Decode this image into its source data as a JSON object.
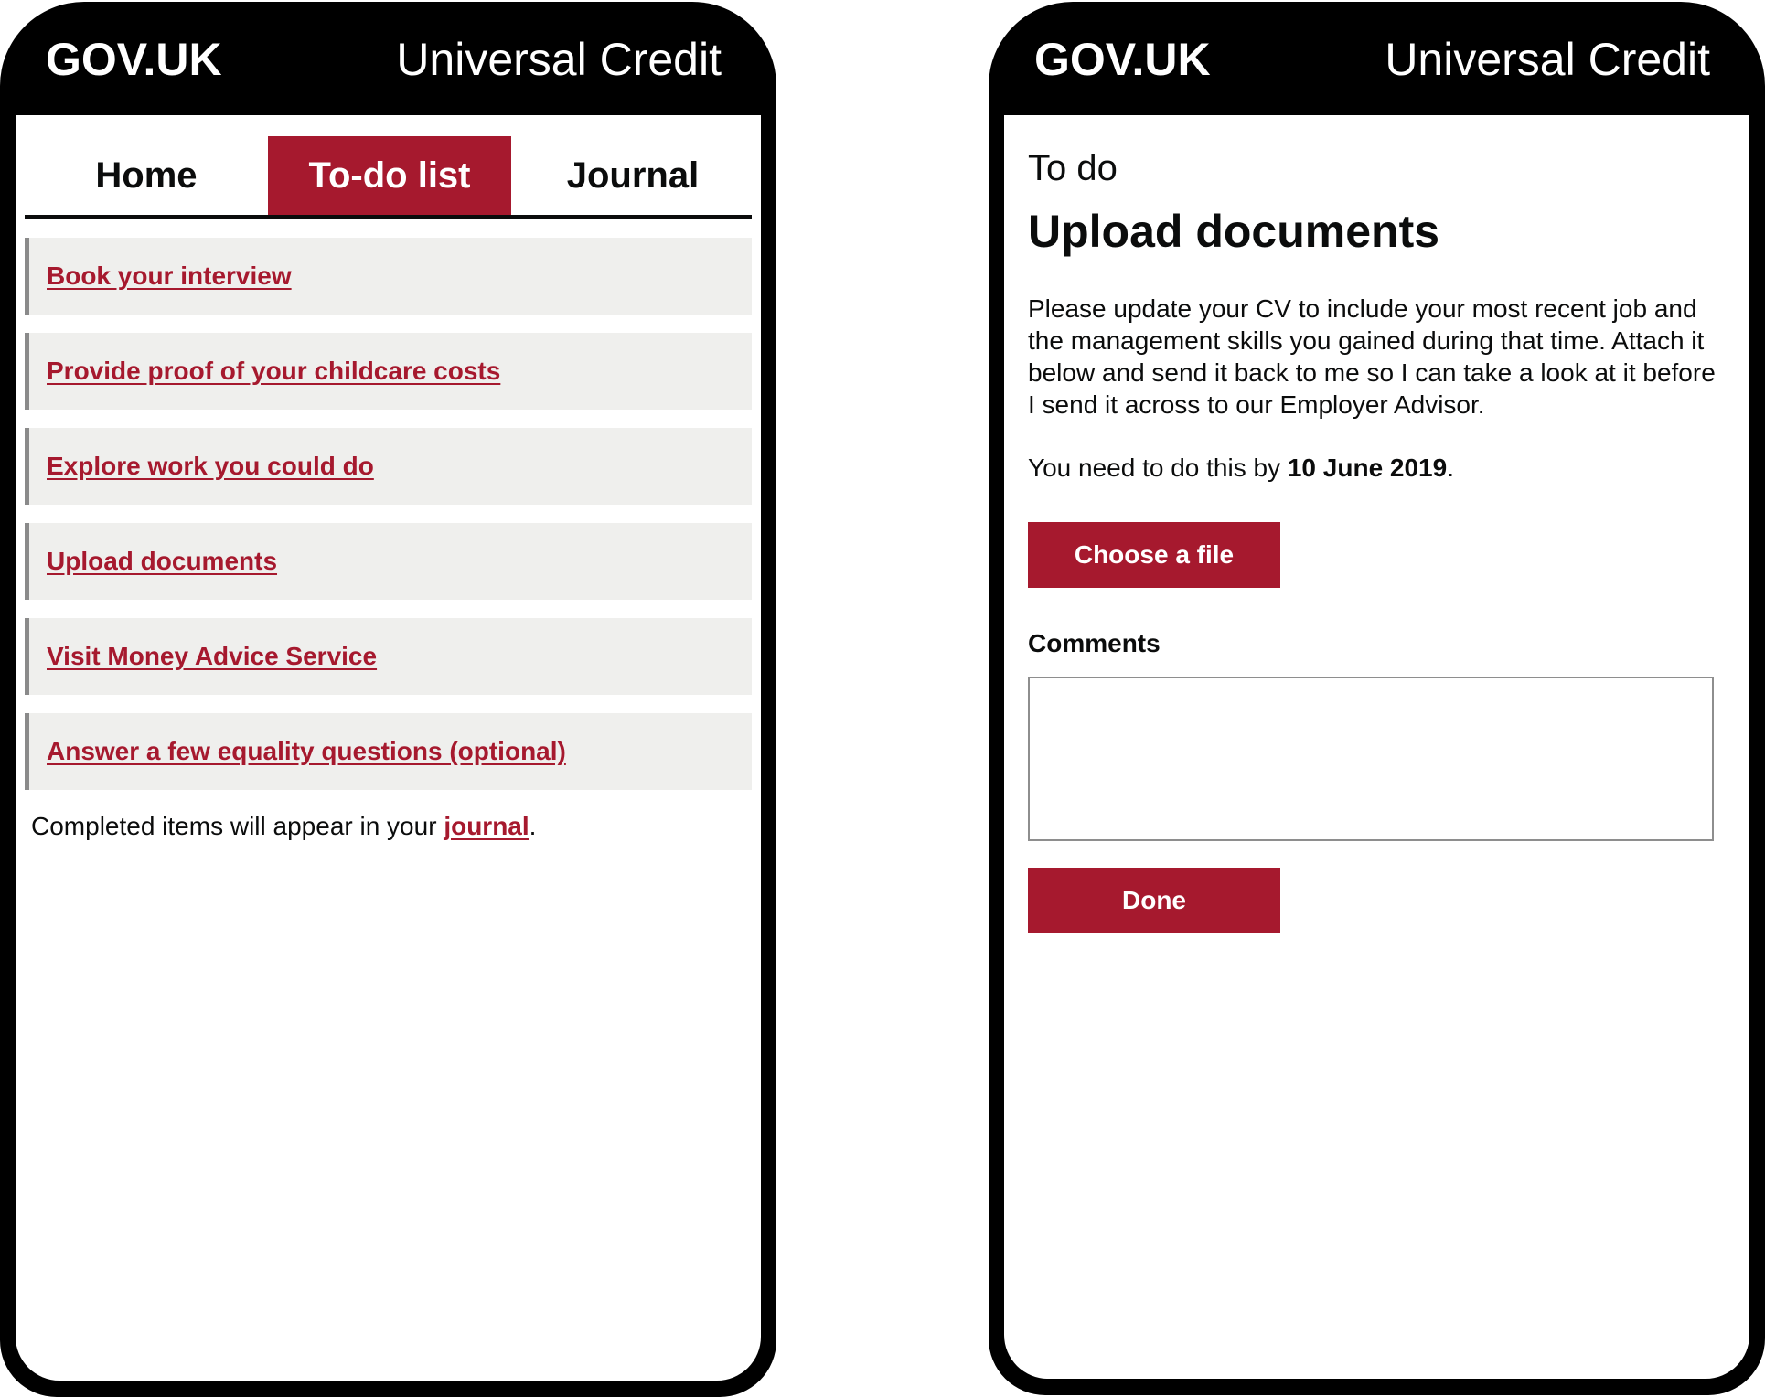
{
  "colors": {
    "brand_red": "#a6192e",
    "frame": "#000000",
    "item_bg": "#efefed",
    "item_border": "#8a8a8a"
  },
  "left_phone": {
    "header": {
      "brand": "GOV.UK",
      "service": "Universal Credit"
    },
    "tabs": [
      {
        "label": "Home",
        "active": false
      },
      {
        "label": "To-do list",
        "active": true
      },
      {
        "label": "Journal",
        "active": false
      }
    ],
    "todo_items": [
      {
        "label": "Book your interview"
      },
      {
        "label": "Provide proof of your childcare costs"
      },
      {
        "label": "Explore work you could do"
      },
      {
        "label": "Upload documents"
      },
      {
        "label": "Visit Money Advice Service"
      },
      {
        "label": "Answer a few equality questions (optional)"
      }
    ],
    "footnote": {
      "prefix": "Completed items will appear in your ",
      "link": "journal",
      "suffix": "."
    }
  },
  "right_phone": {
    "header": {
      "brand": "GOV.UK",
      "service": "Universal Credit"
    },
    "caption": "To do",
    "title": "Upload documents",
    "body": "Please update your CV to include your most recent job and the management skills you gained during that time. Attach it below and send it back to me so I can take a look at it before I send it across to our Employer Advisor.",
    "deadline": {
      "prefix": "You need to do this by ",
      "date": "10 June 2019",
      "suffix": "."
    },
    "choose_file_label": "Choose a file",
    "comments_label": "Comments",
    "comments_value": "",
    "done_label": "Done"
  }
}
